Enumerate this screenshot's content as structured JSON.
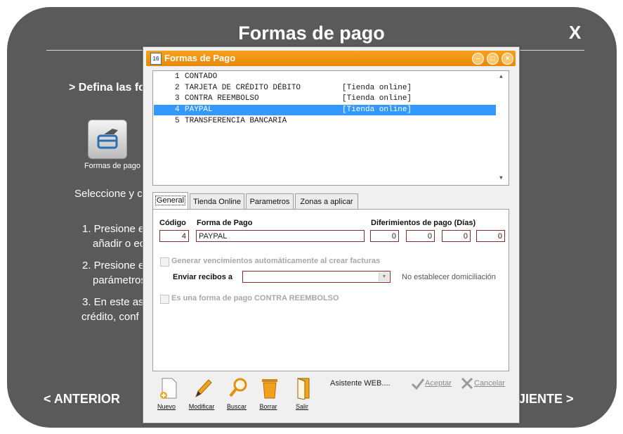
{
  "wizard": {
    "title": "Formas de pago",
    "close": "X",
    "define": "> Defina las fo",
    "icon_label": "Formas de pago",
    "select_line": "Seleccione y co",
    "step1a": "1. Presione e",
    "step1b": "añadir o ec",
    "step2a": "2. Presione e",
    "step2b": "parámetros",
    "step3a": "3. En este as",
    "step3b": "crédito, conf",
    "prev": "< ANTERIOR",
    "next": "JIENTE >"
  },
  "dialog": {
    "title": "Formas de Pago",
    "icon_text": "16",
    "list": [
      {
        "num": "1",
        "name": "CONTADO",
        "tag": "",
        "selected": false
      },
      {
        "num": "2",
        "name": "TARJETA DE CRÉDITO DÉBITO",
        "tag": "[Tienda online]",
        "selected": false
      },
      {
        "num": "3",
        "name": "CONTRA REEMBOLSO",
        "tag": "[Tienda online]",
        "selected": false
      },
      {
        "num": "4",
        "name": "PAYPAL",
        "tag": "[Tienda online]",
        "selected": true
      },
      {
        "num": "5",
        "name": "TRANSFERENCIA BANCARIA",
        "tag": "",
        "selected": false
      }
    ],
    "tabs": [
      "General",
      "Tienda Online",
      "Parametros",
      "Zonas a aplicar"
    ],
    "form": {
      "codigo_label": "Código",
      "codigo_value": "4",
      "forma_label": "Forma de Pago",
      "forma_value": "PAYPAL",
      "dif_label": "Diferimientos de pago (Días)",
      "dif_values": [
        "0",
        "0",
        "0",
        "0"
      ],
      "gen_venc": "Generar vencimientos automáticamente al crear facturas",
      "enviar_label": "Enviar recibos a",
      "enviar_value": "",
      "no_domic": "No establecer domiciliación",
      "contra_reemb": "Es una forma de pago CONTRA REEMBOLSO"
    },
    "toolbar": {
      "nuevo": "Nuevo",
      "modificar": "Modificar",
      "buscar": "Buscar",
      "borrar": "Borrar",
      "salir": "Salir",
      "asistente": "Asistente WEB....",
      "aceptar": "Aceptar",
      "cancelar": "Cancelar"
    }
  }
}
